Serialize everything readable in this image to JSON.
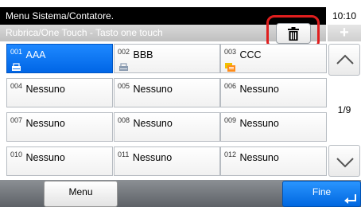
{
  "header": {
    "title": "Menu Sistema/Contatore.",
    "clock": "10:10"
  },
  "subheader": {
    "title": "Rubrica/One Touch - Tasto one touch",
    "plus_label": "+"
  },
  "slots": [
    {
      "num": "001",
      "name": "AAA",
      "icon": "contact-icon",
      "selected": true
    },
    {
      "num": "002",
      "name": "BBB",
      "icon": "contact-icon",
      "selected": false
    },
    {
      "num": "003",
      "name": "CCC",
      "icon": "group-icon",
      "selected": false
    },
    {
      "num": "004",
      "name": "Nessuno",
      "icon": "",
      "selected": false
    },
    {
      "num": "005",
      "name": "Nessuno",
      "icon": "",
      "selected": false
    },
    {
      "num": "006",
      "name": "Nessuno",
      "icon": "",
      "selected": false
    },
    {
      "num": "007",
      "name": "Nessuno",
      "icon": "",
      "selected": false
    },
    {
      "num": "008",
      "name": "Nessuno",
      "icon": "",
      "selected": false
    },
    {
      "num": "009",
      "name": "Nessuno",
      "icon": "",
      "selected": false
    },
    {
      "num": "010",
      "name": "Nessuno",
      "icon": "",
      "selected": false
    },
    {
      "num": "011",
      "name": "Nessuno",
      "icon": "",
      "selected": false
    },
    {
      "num": "012",
      "name": "Nessuno",
      "icon": "",
      "selected": false
    }
  ],
  "pager": {
    "indicator": "1/9"
  },
  "footer": {
    "menu_label": "Menu",
    "fine_label": "Fine"
  },
  "colors": {
    "accent": "#0a74f2",
    "highlight": "#e01e1e"
  }
}
